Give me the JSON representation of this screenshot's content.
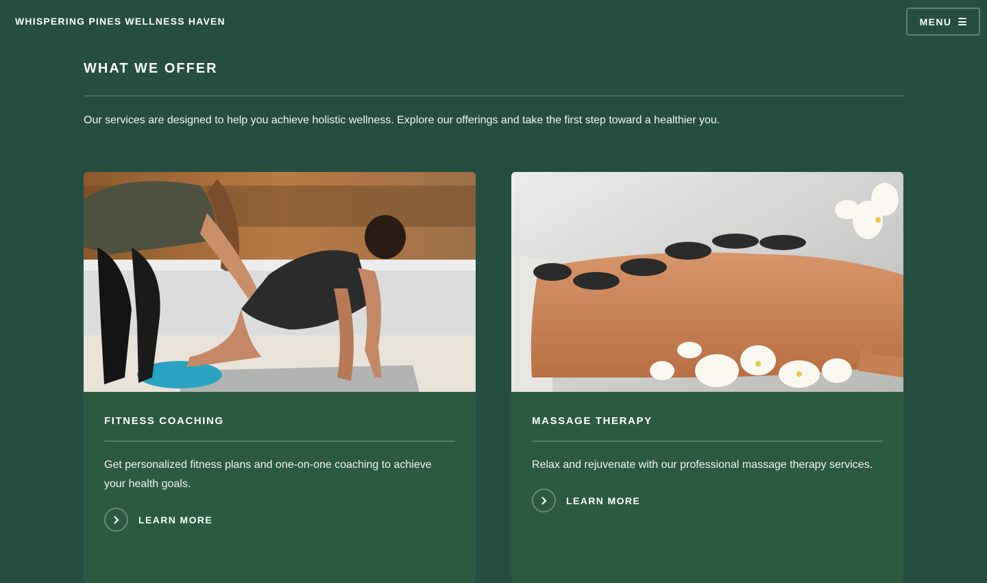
{
  "header": {
    "brand": "WHISPERING PINES WELLNESS HAVEN",
    "menu_label": "MENU"
  },
  "offers": {
    "title": "WHAT WE OFFER",
    "intro": "Our services are designed to help you achieve holistic wellness. Explore our offerings and take the first step toward a healthier you."
  },
  "cards": [
    {
      "title": "FITNESS COACHING",
      "text": "Get personalized fitness plans and one-on-one coaching to achieve your health goals.",
      "cta": "LEARN MORE",
      "image": "fitness-coaching-photo"
    },
    {
      "title": "MASSAGE THERAPY",
      "text": "Relax and rejuvenate with our professional massage therapy services.",
      "cta": "LEARN MORE",
      "image": "massage-therapy-photo"
    }
  ],
  "colors": {
    "background": "#264e40",
    "card": "#2c5a40",
    "text": "#ffffff"
  }
}
